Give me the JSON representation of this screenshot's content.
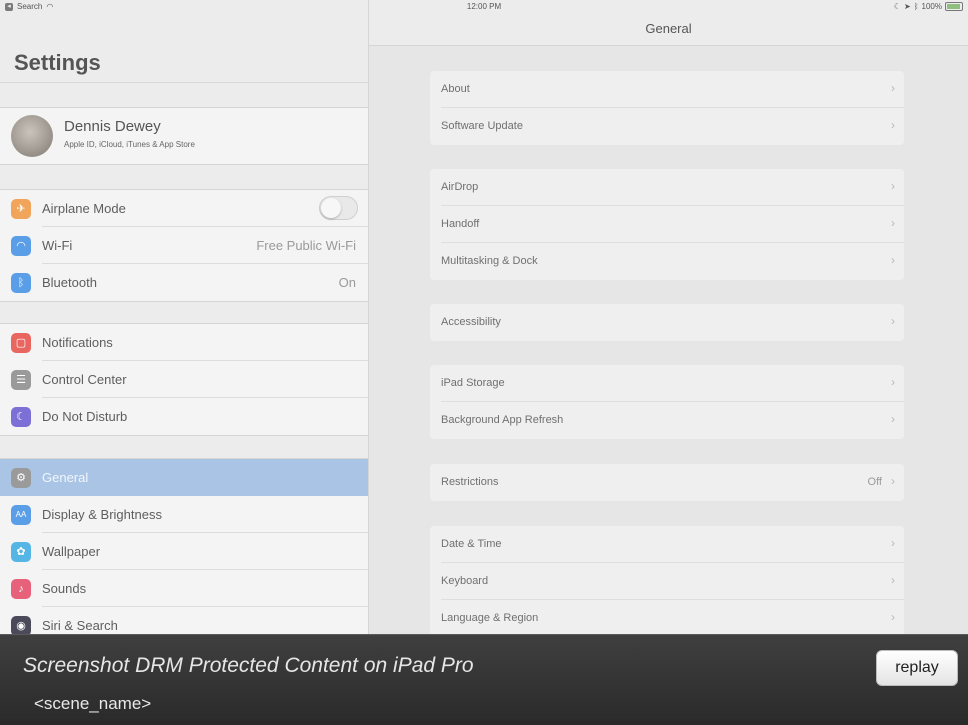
{
  "status_bar": {
    "back_label": "Search",
    "time": "12:00 PM",
    "battery": "100%"
  },
  "sidebar": {
    "title": "Settings",
    "profile": {
      "name": "Dennis Dewey",
      "subtitle": "Apple ID, iCloud, iTunes & App Store"
    },
    "groups": [
      [
        {
          "label": "Airplane Mode",
          "icon": "airplane-icon",
          "color": "#f0a55a",
          "toggle": true
        },
        {
          "label": "Wi-Fi",
          "icon": "wifi-icon",
          "color": "#5b9ee8",
          "value": "Free Public Wi-Fi"
        },
        {
          "label": "Bluetooth",
          "icon": "bluetooth-icon",
          "color": "#5b9ee8",
          "value": "On"
        }
      ],
      [
        {
          "label": "Notifications",
          "icon": "notifications-icon",
          "color": "#e8665f"
        },
        {
          "label": "Control Center",
          "icon": "control-center-icon",
          "color": "#9a9a9a"
        },
        {
          "label": "Do Not Disturb",
          "icon": "moon-icon",
          "color": "#7c6fd6"
        }
      ],
      [
        {
          "label": "General",
          "icon": "gear-icon",
          "color": "#9a9a9a",
          "selected": true
        },
        {
          "label": "Display & Brightness",
          "icon": "display-icon",
          "color": "#5b9ee8"
        },
        {
          "label": "Wallpaper",
          "icon": "wallpaper-icon",
          "color": "#55b6e6"
        },
        {
          "label": "Sounds",
          "icon": "sounds-icon",
          "color": "#e8617a"
        },
        {
          "label": "Siri & Search",
          "icon": "siri-icon",
          "color": "#4a4a5a"
        }
      ]
    ]
  },
  "detail": {
    "title": "General",
    "groups": [
      [
        {
          "label": "About"
        },
        {
          "label": "Software Update"
        }
      ],
      [
        {
          "label": "AirDrop"
        },
        {
          "label": "Handoff"
        },
        {
          "label": "Multitasking & Dock"
        }
      ],
      [
        {
          "label": "Accessibility"
        }
      ],
      [
        {
          "label": "iPad Storage"
        },
        {
          "label": "Background App Refresh"
        }
      ],
      [
        {
          "label": "Restrictions",
          "value": "Off"
        }
      ],
      [
        {
          "label": "Date & Time"
        },
        {
          "label": "Keyboard"
        },
        {
          "label": "Language & Region"
        }
      ]
    ]
  },
  "overlay": {
    "title": "Screenshot DRM Protected Content on iPad Pro",
    "scene": "<scene_name>",
    "replay_label": "replay"
  }
}
